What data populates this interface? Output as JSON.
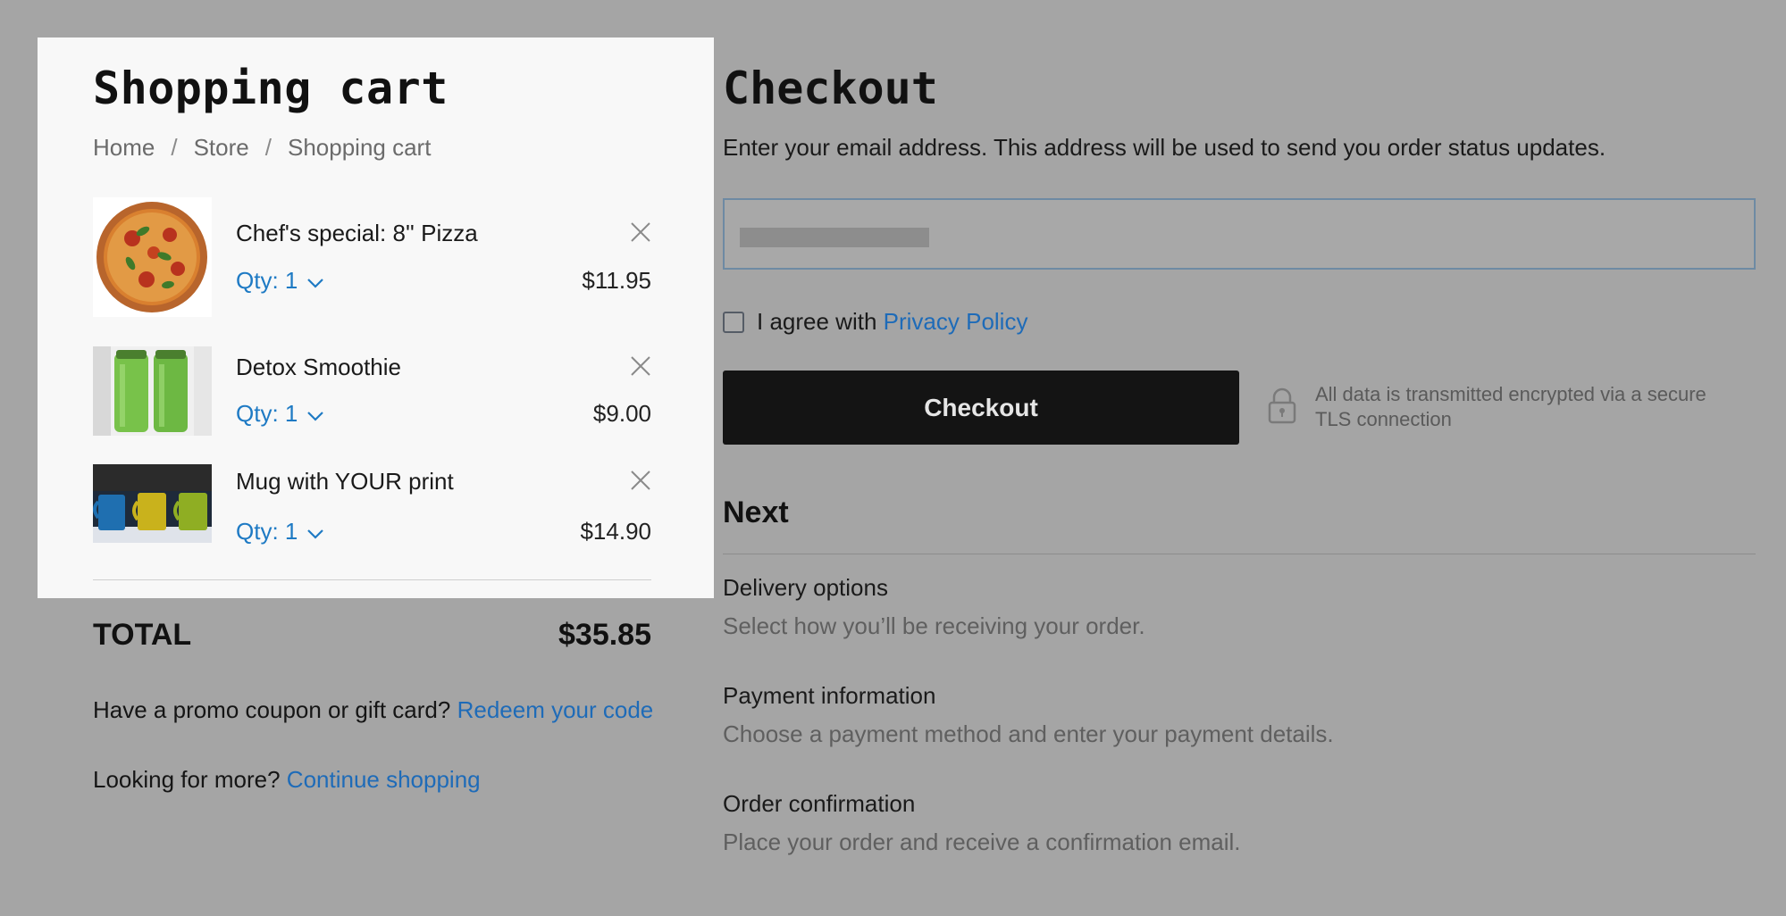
{
  "cart": {
    "title": "Shopping cart",
    "breadcrumb": [
      "Home",
      "Store",
      "Shopping cart"
    ],
    "breadcrumb_sep": "/",
    "items": [
      {
        "name": "Chef's special: 8'' Pizza",
        "qty": "Qty: 1",
        "price": "$11.95",
        "image": "pizza"
      },
      {
        "name": "Detox Smoothie",
        "qty": "Qty: 1",
        "price": "$9.00",
        "image": "smoothie-bottles"
      },
      {
        "name": "Mug with YOUR print",
        "qty": "Qty: 1",
        "price": "$14.90",
        "image": "mugs"
      }
    ],
    "total_label": "TOTAL",
    "total_value": "$35.85",
    "promo_text": "Have a promo coupon or gift card?",
    "promo_link": "Redeem your code",
    "more_text": "Looking for more?",
    "more_link": "Continue shopping"
  },
  "checkout": {
    "title": "Checkout",
    "description": "Enter your email address. This address will be used to send you order status updates.",
    "email_value": "c",
    "agree_text": "I agree with",
    "privacy_link": "Privacy Policy",
    "button_label": "Checkout",
    "secure_text": "All data is transmitted encrypted via a secure TLS connection",
    "secure_icon": "lock-icon"
  },
  "next": {
    "title": "Next",
    "steps": [
      {
        "title": "Delivery options",
        "desc": "Select how you’ll be receiving your order."
      },
      {
        "title": "Payment information",
        "desc": "Choose a payment method and enter your payment details."
      },
      {
        "title": "Order confirmation",
        "desc": "Place your order and receive a confirmation email."
      }
    ]
  },
  "colors": {
    "overlay": "#a5a5a5",
    "panel": "#f8f8f8",
    "link": "#1e6bb8",
    "qty": "#1e7ac4",
    "button": "#141414"
  }
}
